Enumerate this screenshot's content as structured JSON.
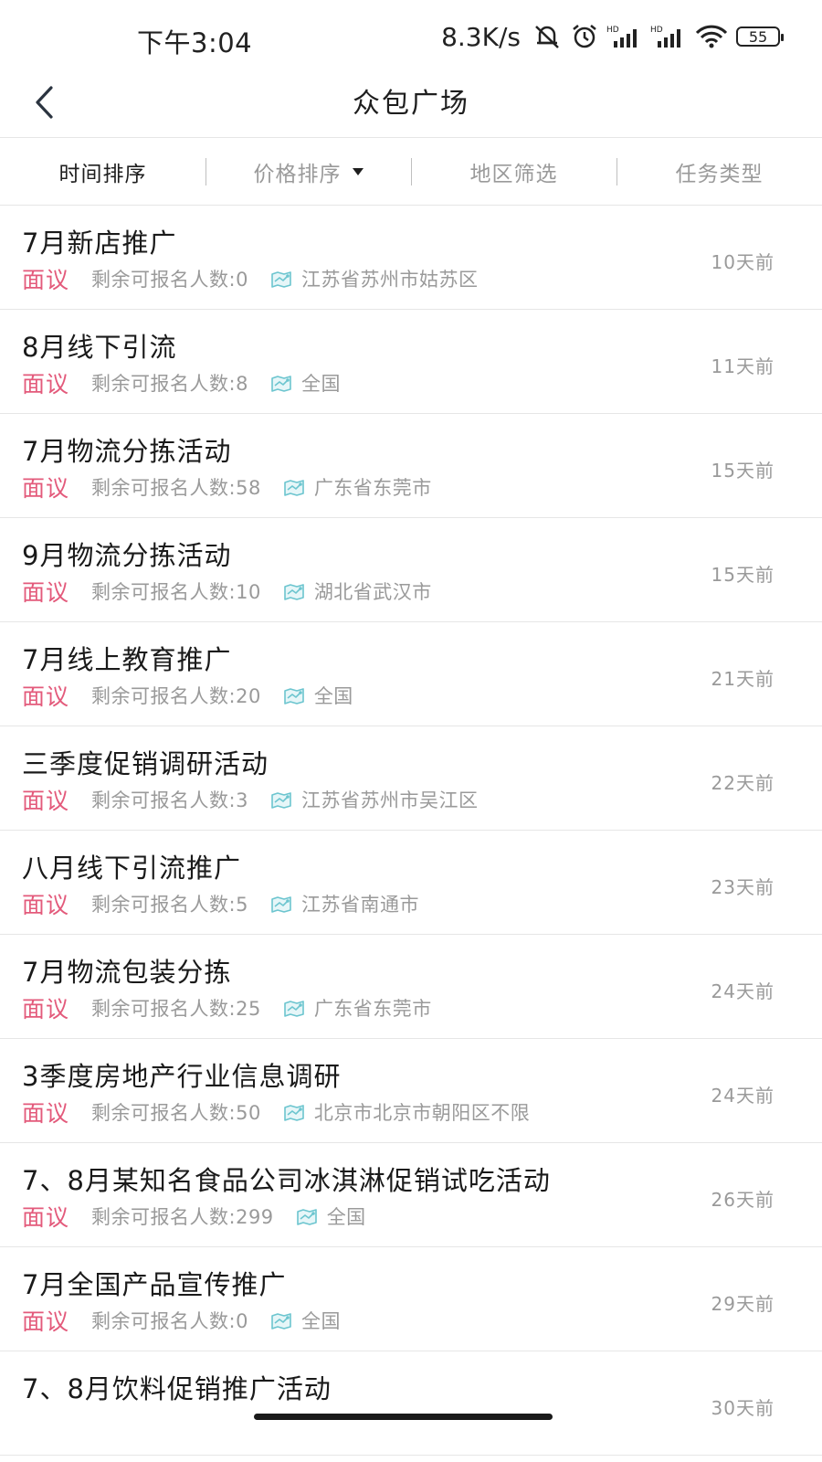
{
  "status_bar": {
    "time": "下午3:04",
    "net_speed": "8.3K/s",
    "battery": "55",
    "icons": [
      "mute-bell-icon",
      "alarm-icon",
      "hd-signal-icon",
      "hd-signal-icon",
      "wifi-icon",
      "battery-icon"
    ]
  },
  "nav": {
    "title": "众包广场",
    "back_icon": "chevron-left-icon"
  },
  "filters": [
    {
      "label": "时间排序",
      "active": true
    },
    {
      "label": "价格排序",
      "active": false,
      "has_dropdown": true
    },
    {
      "label": "地区筛选",
      "active": false
    },
    {
      "label": "任务类型",
      "active": false
    }
  ],
  "colors": {
    "price": "#e35a7b",
    "meta": "#9a9a9a",
    "map_icon": "#6cc5cf"
  },
  "tasks": [
    {
      "title": "7月新店推广",
      "price": "面议",
      "remain": "剩余可报名人数:0",
      "region": "江苏省苏州市姑苏区",
      "time": "10天前"
    },
    {
      "title": "8月线下引流",
      "price": "面议",
      "remain": "剩余可报名人数:8",
      "region": "全国",
      "time": "11天前"
    },
    {
      "title": "7月物流分拣活动",
      "price": "面议",
      "remain": "剩余可报名人数:58",
      "region": "广东省东莞市",
      "time": "15天前"
    },
    {
      "title": "9月物流分拣活动",
      "price": "面议",
      "remain": "剩余可报名人数:10",
      "region": "湖北省武汉市",
      "time": "15天前"
    },
    {
      "title": "7月线上教育推广",
      "price": "面议",
      "remain": "剩余可报名人数:20",
      "region": "全国",
      "time": "21天前"
    },
    {
      "title": "三季度促销调研活动",
      "price": "面议",
      "remain": "剩余可报名人数:3",
      "region": "江苏省苏州市吴江区",
      "time": "22天前"
    },
    {
      "title": "八月线下引流推广",
      "price": "面议",
      "remain": "剩余可报名人数:5",
      "region": "江苏省南通市",
      "time": "23天前"
    },
    {
      "title": "7月物流包装分拣",
      "price": "面议",
      "remain": "剩余可报名人数:25",
      "region": "广东省东莞市",
      "time": "24天前"
    },
    {
      "title": "3季度房地产行业信息调研",
      "price": "面议",
      "remain": "剩余可报名人数:50",
      "region": "北京市北京市朝阳区不限",
      "time": "24天前"
    },
    {
      "title": "7、8月某知名食品公司冰淇淋促销试吃活动",
      "price": "面议",
      "remain": "剩余可报名人数:299",
      "region": "全国",
      "time": "26天前"
    },
    {
      "title": "7月全国产品宣传推广",
      "price": "面议",
      "remain": "剩余可报名人数:0",
      "region": "全国",
      "time": "29天前"
    },
    {
      "title": "7、8月饮料促销推广活动",
      "price": "",
      "remain": "",
      "region": "",
      "time": "30天前"
    }
  ]
}
